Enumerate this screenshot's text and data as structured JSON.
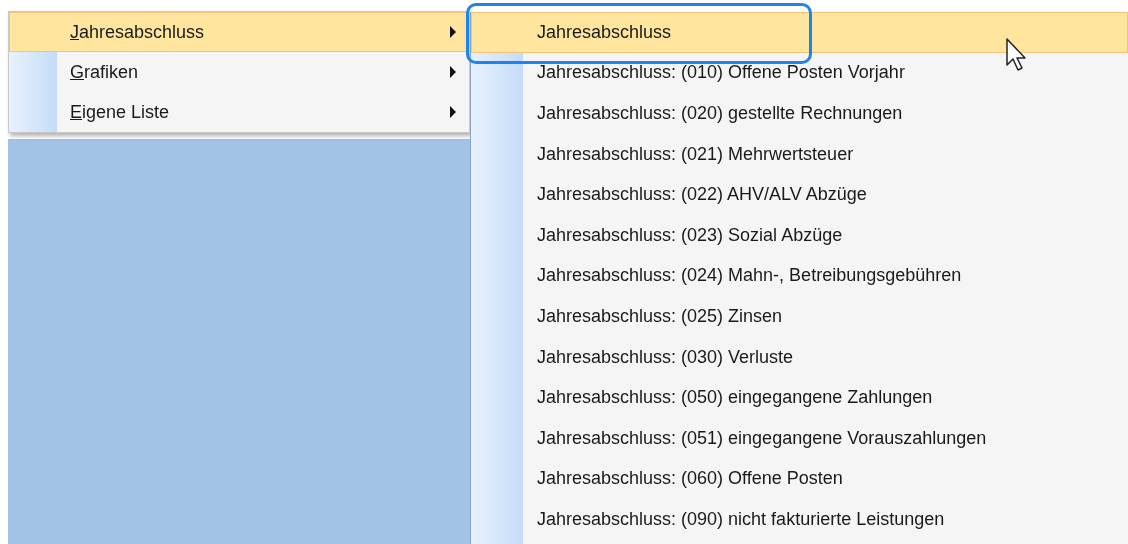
{
  "menu": {
    "items": [
      {
        "label": "Jahresabschluss",
        "selected": true,
        "has_submenu": true
      },
      {
        "label": "Grafiken",
        "selected": false,
        "has_submenu": true
      },
      {
        "label": "Eigene Liste",
        "selected": false,
        "has_submenu": true
      }
    ]
  },
  "submenu": {
    "items": [
      {
        "label": "Jahresabschluss",
        "selected": true,
        "outlined": true
      },
      {
        "label": "Jahresabschluss: (010) Offene Posten Vorjahr",
        "selected": false,
        "outlined": false
      },
      {
        "label": "Jahresabschluss: (020) gestellte Rechnungen",
        "selected": false,
        "outlined": false
      },
      {
        "label": "Jahresabschluss: (021) Mehrwertsteuer",
        "selected": false,
        "outlined": false
      },
      {
        "label": "Jahresabschluss: (022) AHV/ALV Abzüge",
        "selected": false,
        "outlined": false
      },
      {
        "label": "Jahresabschluss: (023) Sozial Abzüge",
        "selected": false,
        "outlined": false
      },
      {
        "label": "Jahresabschluss: (024) Mahn-, Betreibungsgebühren",
        "selected": false,
        "outlined": false
      },
      {
        "label": "Jahresabschluss: (025) Zinsen",
        "selected": false,
        "outlined": false
      },
      {
        "label": "Jahresabschluss: (030) Verluste",
        "selected": false,
        "outlined": false
      },
      {
        "label": "Jahresabschluss: (050) eingegangene Zahlungen",
        "selected": false,
        "outlined": false
      },
      {
        "label": "Jahresabschluss: (051) eingegangene Vorauszahlungen",
        "selected": false,
        "outlined": false
      },
      {
        "label": "Jahresabschluss: (060) Offene Posten",
        "selected": false,
        "outlined": false
      },
      {
        "label": "Jahresabschluss: (090) nicht fakturierte Leistungen",
        "selected": false,
        "outlined": false
      }
    ]
  }
}
